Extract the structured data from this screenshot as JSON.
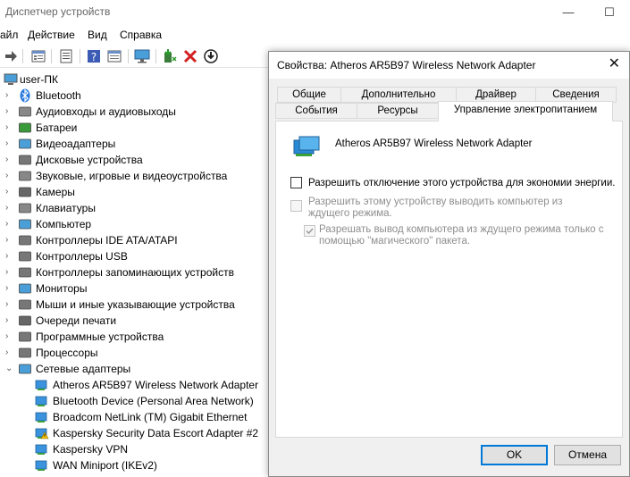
{
  "window": {
    "title": "Диспетчер устройств",
    "controls": {
      "minimize": "—",
      "maximize": "☐"
    }
  },
  "menu": [
    "айл",
    "Действие",
    "Вид",
    "Справка"
  ],
  "toolbar": {
    "icons": [
      "forward-icon",
      "properties-icon",
      "list-icon",
      "help-icon",
      "update-icon",
      "monitor-icon",
      "enable-device-icon",
      "delete-icon",
      "download-icon"
    ]
  },
  "tree": {
    "root": "user-ПК",
    "categories": [
      "Bluetooth",
      "Аудиовходы и аудиовыходы",
      "Батареи",
      "Видеоадаптеры",
      "Дисковые устройства",
      "Звуковые, игровые и видеоустройства",
      "Камеры",
      "Клавиатуры",
      "Компьютер",
      "Контроллеры IDE ATA/ATAPI",
      "Контроллеры USB",
      "Контроллеры запоминающих устройств",
      "Мониторы",
      "Мыши и иные указывающие устройства",
      "Очереди печати",
      "Программные устройства",
      "Процессоры",
      "Сетевые адаптеры"
    ],
    "network_adapters": [
      "Atheros AR5B97 Wireless Network Adapter",
      "Bluetooth Device (Personal Area Network)",
      "Broadcom NetLink (TM) Gigabit Ethernet",
      "Kaspersky Security Data Escort Adapter #2",
      "Kaspersky VPN",
      "WAN Miniport (IKEv2)"
    ]
  },
  "dialog": {
    "title": "Свойства: Atheros AR5B97 Wireless Network Adapter",
    "close": "✕",
    "tabs_row1": [
      "Общие",
      "Дополнительно",
      "Драйвер",
      "Сведения"
    ],
    "tabs_row2": [
      "События",
      "Ресурсы",
      "Управление электропитанием"
    ],
    "active_tab": "Управление электропитанием",
    "device_name": "Atheros AR5B97 Wireless Network Adapter",
    "options": [
      {
        "label": "Разрешить отключение этого устройства для экономии энергии.",
        "checked": false,
        "enabled": true
      },
      {
        "label": "Разрешить этому устройству выводить компьютер из ждущего режима.",
        "checked": false,
        "enabled": false
      },
      {
        "label": "Разрешать вывод компьютера из ждущего режима только с помощью \"магического\" пакета.",
        "checked": true,
        "enabled": false
      }
    ],
    "ok": "OK",
    "cancel": "Отмена"
  }
}
